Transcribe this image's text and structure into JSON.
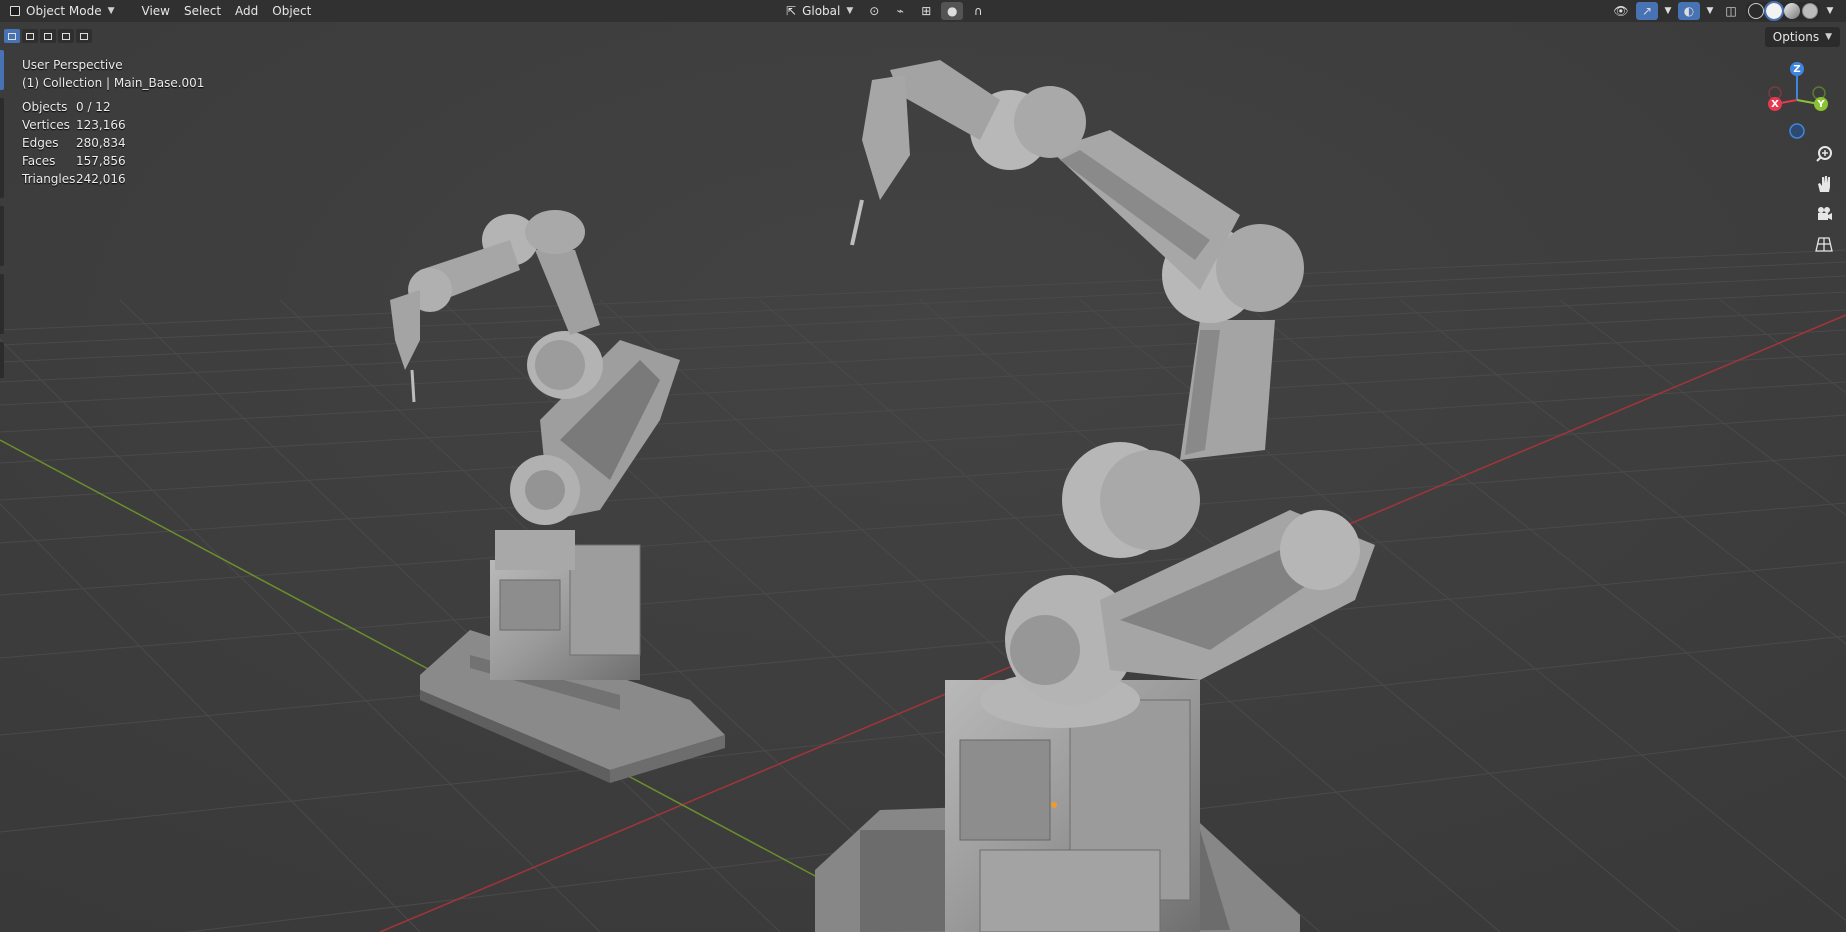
{
  "header": {
    "mode_label": "Object Mode",
    "menus": [
      "View",
      "Select",
      "Add",
      "Object"
    ],
    "orientation_label": "Global"
  },
  "tool_header": {
    "options_label": "Options"
  },
  "viewport_overlay": {
    "view_name": "User Perspective",
    "collection_info": "(1) Collection | Main_Base.001",
    "stats": [
      {
        "label": "Objects",
        "value": "0 / 12"
      },
      {
        "label": "Vertices",
        "value": "123,166"
      },
      {
        "label": "Edges",
        "value": "280,834"
      },
      {
        "label": "Faces",
        "value": "157,856"
      },
      {
        "label": "Triangles",
        "value": "242,016"
      }
    ]
  },
  "gizmo": {
    "axis_z": "Z",
    "axis_y": "Y",
    "axis_x": "X"
  },
  "colors": {
    "accent": "#4772b3",
    "axis_x": "#e6394f",
    "axis_y": "#8bc234",
    "axis_z": "#3f86e0",
    "background": "#3d3d3d"
  }
}
